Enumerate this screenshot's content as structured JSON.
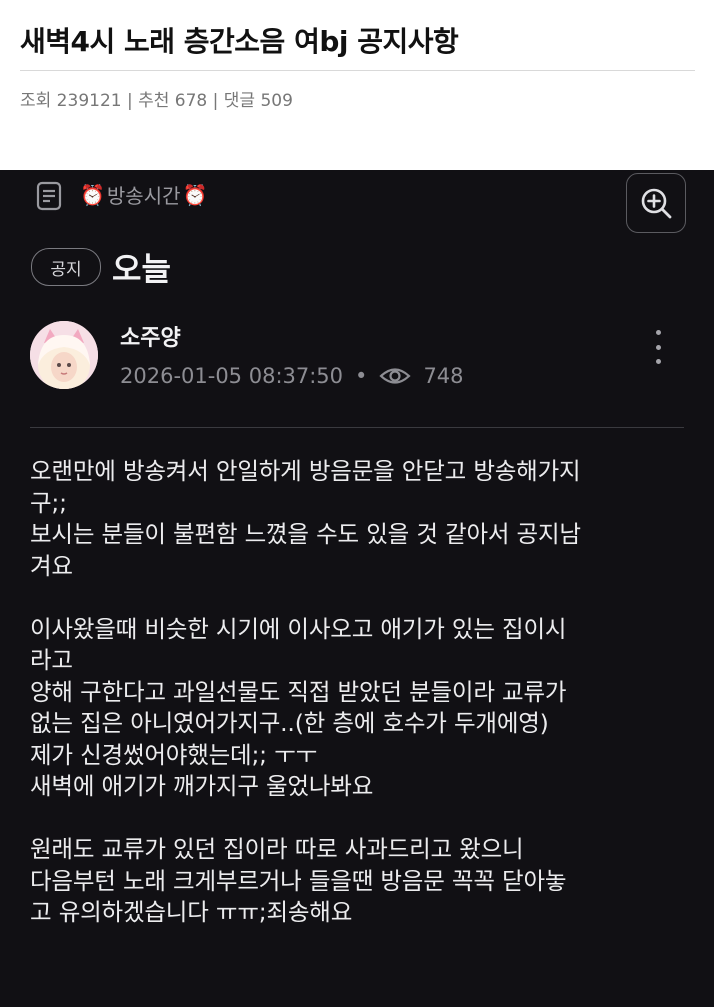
{
  "post": {
    "title": "새벽4시 노래 층간소음 여bj 공지사항",
    "stats": "조회 239121 | 추천 678 | 댓글 509"
  },
  "app": {
    "channel_name": "방송시간",
    "notice_badge": "공지",
    "heading": "오늘",
    "author": "소주양",
    "datetime": "2026-01-05 08:37:50",
    "meta_separator": "•",
    "views": "748"
  },
  "body": {
    "p1_line1": "오랜만에 방송켜서 안일하게 방음문을 안닫고 방송해가지",
    "p1_line2": "구;;",
    "p1_line3": "보시는 분들이 불편함 느꼈을 수도 있을 것 같아서 공지남",
    "p1_line4": "겨요",
    "p2_line1": "이사왔을때 비슷한 시기에 이사오고 애기가 있는 집이시",
    "p2_line2": "라고",
    "p2_line3": "양해 구한다고 과일선물도 직접 받았던 분들이라 교류가",
    "p2_line4": "없는 집은 아니였어가지구..(한 층에 호수가 두개에영)",
    "p2_line5": "제가 신경썼어야했는데;; ㅜㅜ",
    "p2_line6": "새벽에 애기가 깨가지구 울었나봐요",
    "p3_line1": "원래도 교류가 있던 집이라 따로 사과드리고 왔으니",
    "p3_line2": "다음부턴 노래 크게부르거나 들을땐 방음문 꼭꼭 닫아놓",
    "p3_line3": "고 유의하겠습니다 ㅠㅠ;죄송해요"
  },
  "icons": {
    "doc": "document-icon",
    "alarm": "alarm-clock-icon",
    "zoom": "zoom-in-icon",
    "more": "kebab-menu-icon",
    "views": "eye-icon"
  },
  "colors": {
    "dark_bg": "#111014",
    "alarm_red": "#d9453e"
  }
}
